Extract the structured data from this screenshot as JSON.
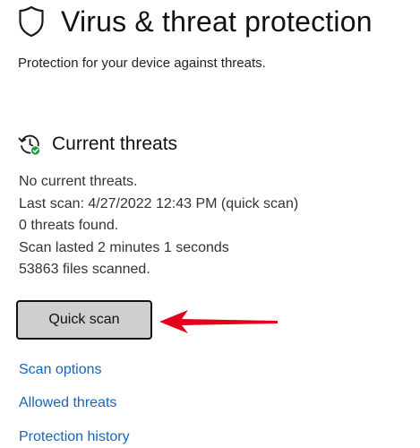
{
  "header": {
    "title": "Virus & threat protection",
    "subtitle": "Protection for your device against threats.",
    "icon": "shield-icon"
  },
  "current_threats": {
    "title": "Current threats",
    "icon": "history-icon",
    "status_lines": [
      "No current threats.",
      "Last scan: 4/27/2022 12:43 PM (quick scan)",
      "0 threats found.",
      "Scan lasted 2 minutes 1 seconds",
      "53863 files scanned."
    ],
    "quick_scan_label": "Quick scan"
  },
  "links": {
    "scan_options": "Scan options",
    "allowed_threats": "Allowed threats",
    "protection_history": "Protection history"
  },
  "colors": {
    "link": "#1565c0",
    "arrow": "#e3001b",
    "status_ok": "#1e9e3a",
    "button_bg": "#cfcfcf"
  }
}
